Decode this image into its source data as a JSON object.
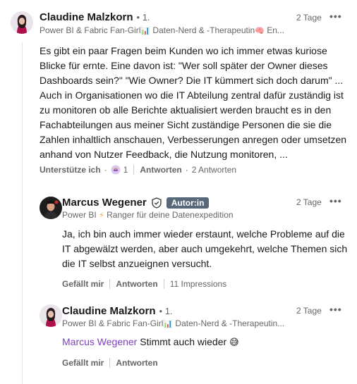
{
  "comments": [
    {
      "author": "Claudine Malzkorn",
      "degree": "• 1.",
      "headline_a": "Power BI & Fabric Fan-Girl",
      "headline_b": "Daten-Nerd & -Therapeutin",
      "headline_c": "En...",
      "time": "2 Tage",
      "more": "•••",
      "text": "Es gibt ein paar Fragen beim Kunden wo ich immer etwas kuriose Blicke für ernte. Eine davon ist: \"Wer soll später der Owner dieses Dashboards sein?\" \"Wie Owner? Die IT kümmert sich doch darum\" ... Auch in Organisationen wo die IT Abteilung zentral dafür zuständig ist zu monitoren ob alle Berichte aktualisiert werden braucht es in den Fachabteilungen aus meiner Sicht zuständige Personen die sie die Zahlen inhaltlich anschauen, Verbesserungen anregen oder umsetzen anhand von Nutzer Feedback, die Nutzung monitoren, ...",
      "support_label": "Unterstütze ich",
      "reaction_count": "1",
      "reply_label": "Antworten",
      "replies_count": "2 Antworten"
    },
    {
      "author": "Marcus Wegener",
      "badge": "Autor:in",
      "headline_a": "Power BI",
      "headline_b": "Ranger für deine Datenexpedition",
      "time": "2 Tage",
      "more": "•••",
      "text": "Ja, ich bin auch immer wieder erstaunt, welche Probleme auf die IT abgewälzt werden, aber auch umgekehrt, welche Themen sich die IT selbst anzueignen versucht.",
      "like_label": "Gefällt mir",
      "reply_label": "Antworten",
      "impressions": "11 Impressions"
    },
    {
      "author": "Claudine Malzkorn",
      "degree": "• 1.",
      "headline_a": "Power BI & Fabric Fan-Girl",
      "headline_b": "Daten-Nerd & -Therapeutin...",
      "time": "2 Tage",
      "more": "•••",
      "mention": "Marcus Wegener",
      "text": "Stimmt auch wieder",
      "like_label": "Gefällt mir",
      "reply_label": "Antworten"
    }
  ],
  "icons": {
    "chart_emoji": "📊",
    "brain_emoji": "🧠",
    "bolt": "⚡",
    "grin_emoji": "😅"
  },
  "colors": {
    "mention": "#7e3fbf",
    "badge_bg": "#56687a",
    "muted": "#666666"
  }
}
